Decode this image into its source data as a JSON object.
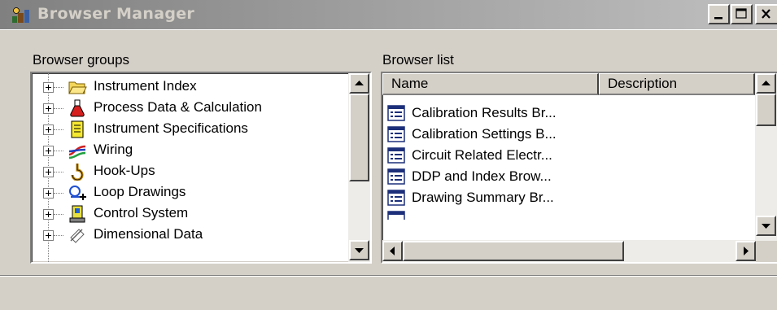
{
  "window": {
    "title": "Browser Manager",
    "buttons": {
      "minimize": "minimize",
      "maximize": "maximize",
      "close": "close"
    }
  },
  "groups": {
    "label": "Browser groups",
    "items": [
      {
        "label": "Instrument Index",
        "icon": "folder-open-icon"
      },
      {
        "label": "Process Data & Calculation",
        "icon": "flask-icon"
      },
      {
        "label": "Instrument Specifications",
        "icon": "spec-sheet-icon"
      },
      {
        "label": "Wiring",
        "icon": "wiring-icon"
      },
      {
        "label": "Hook-Ups",
        "icon": "hook-icon"
      },
      {
        "label": "Loop Drawings",
        "icon": "loop-icon"
      },
      {
        "label": "Control System",
        "icon": "control-system-icon"
      },
      {
        "label": "Dimensional Data",
        "icon": "dimension-icon"
      }
    ]
  },
  "list": {
    "label": "Browser list",
    "columns": [
      "Name",
      "Description"
    ],
    "items": [
      "Calibration Results Br...",
      "Calibration Settings B...",
      "Circuit Related Electr...",
      "DDP and Index Brow...",
      "Drawing Summary Br..."
    ]
  },
  "colors": {
    "titlebar_inactive": "#808080",
    "face": "#d4d0c8"
  }
}
